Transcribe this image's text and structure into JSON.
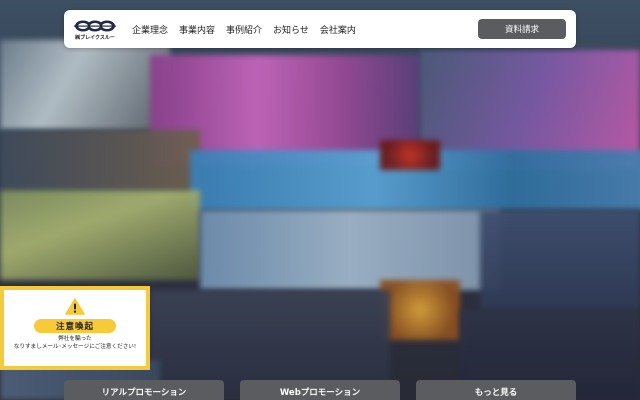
{
  "header": {
    "logo_text": "㈱ブレイクスルー",
    "nav": [
      {
        "label": "企業理念"
      },
      {
        "label": "事業内容"
      },
      {
        "label": "事例紹介"
      },
      {
        "label": "お知らせ"
      },
      {
        "label": "会社案内"
      }
    ],
    "cta_label": "資料請求"
  },
  "notice": {
    "badge": "注意喚起",
    "line1": "弊社を騙った",
    "line2": "なりすましメール･メッセージにご注意ください!",
    "accent_color": "#f7cb37"
  },
  "bottom_buttons": [
    {
      "label": "リアルプロモーション"
    },
    {
      "label": "Webプロモーション"
    },
    {
      "label": "もっと見る"
    }
  ],
  "colors": {
    "button_bg": "#5a5c60",
    "header_bg": "#ffffff"
  }
}
